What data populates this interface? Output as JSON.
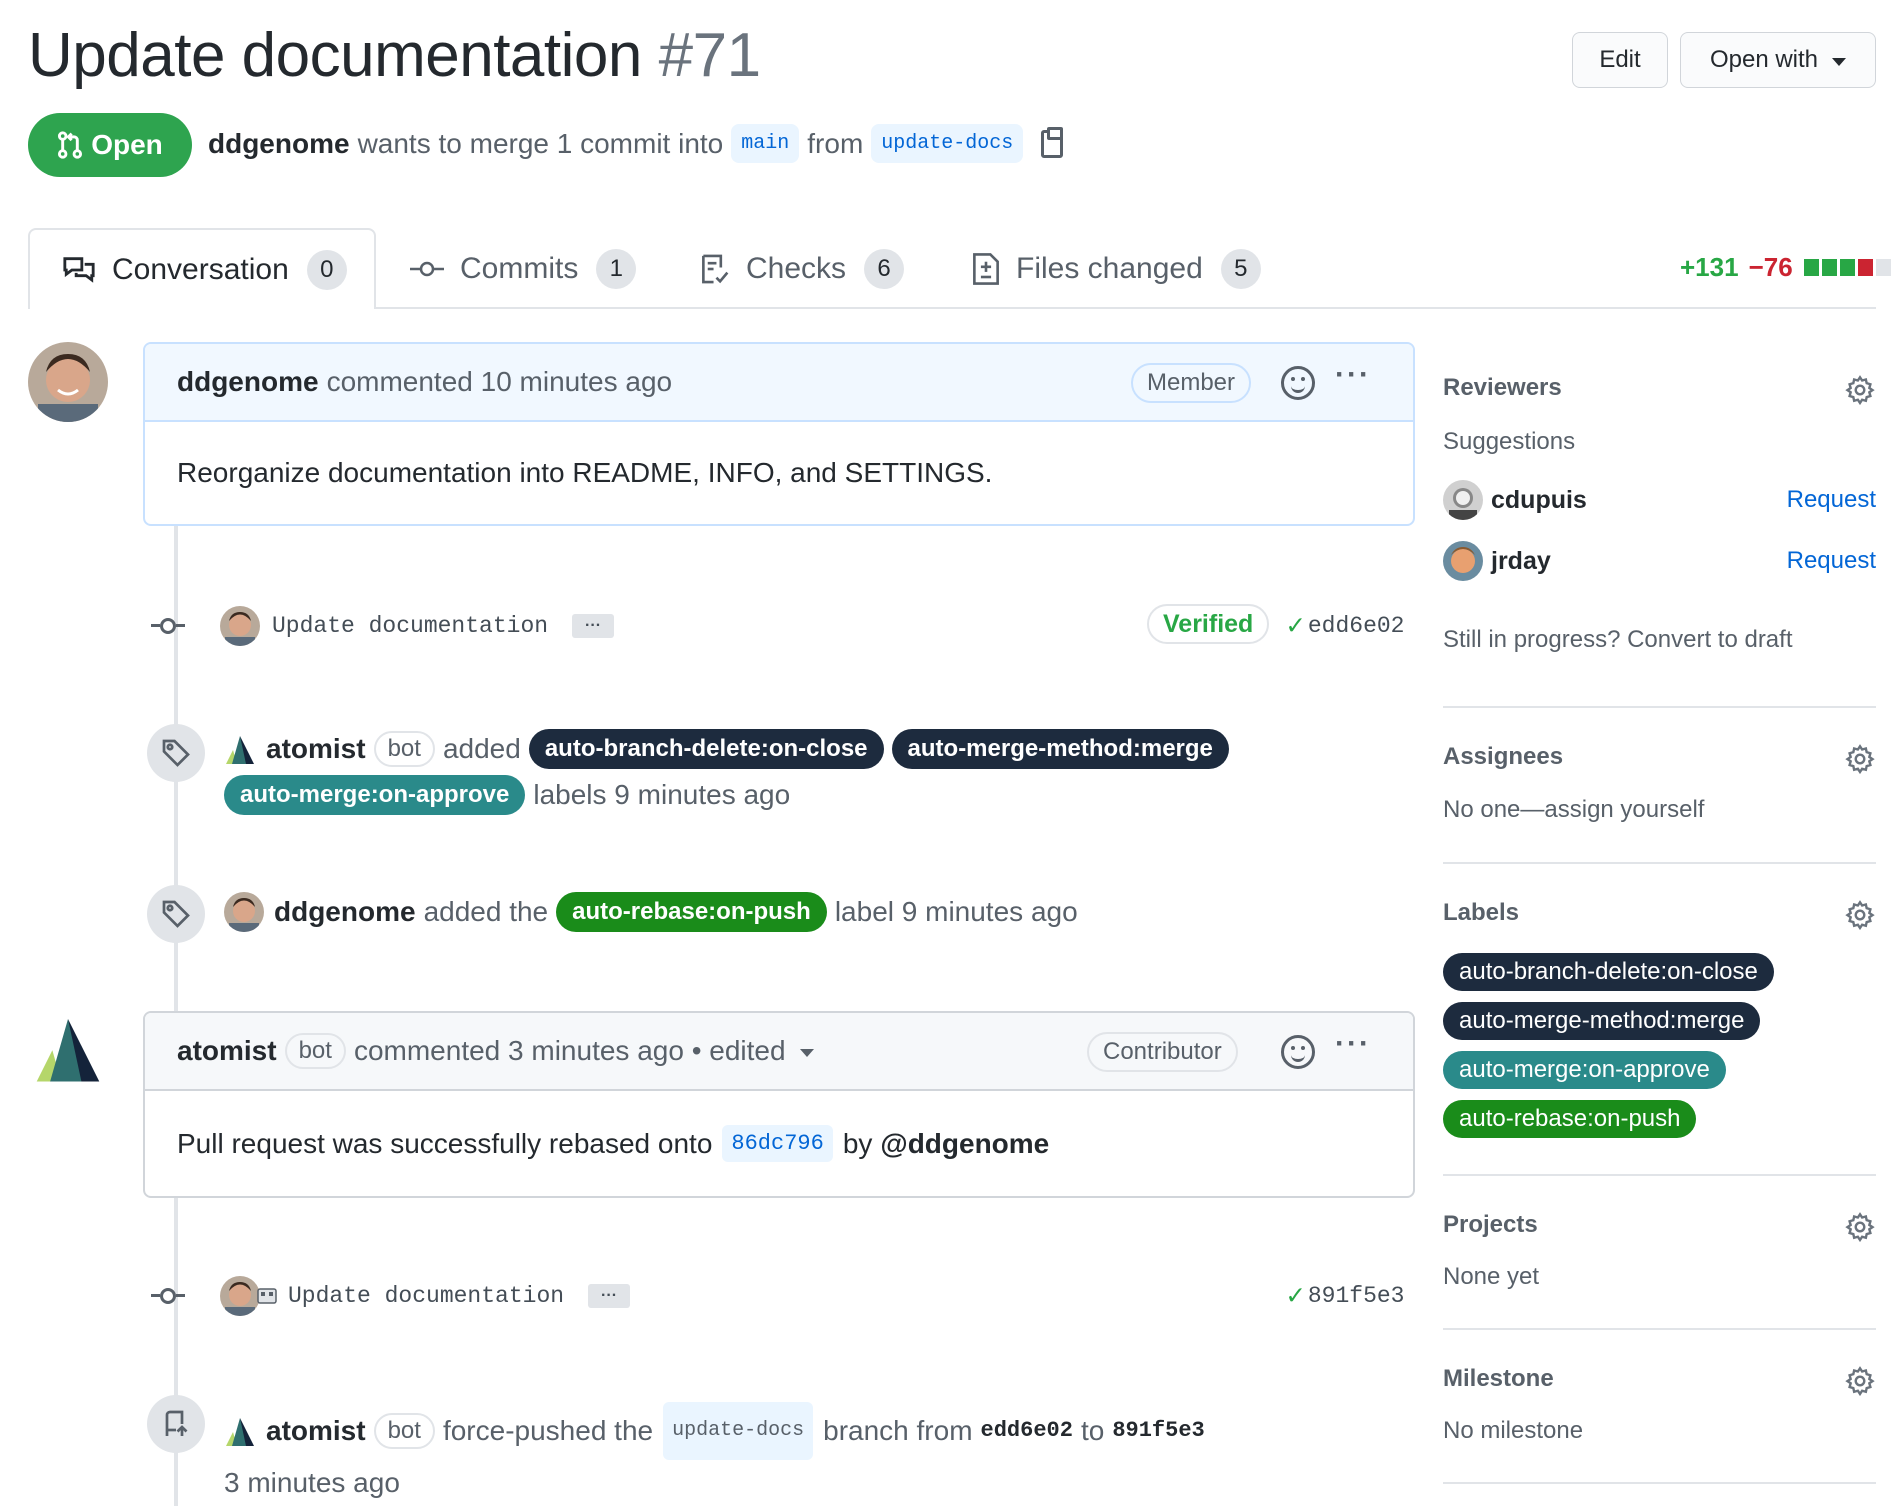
{
  "header": {
    "title": "Update documentation",
    "number": "#71",
    "edit_label": "Edit",
    "open_with_label": "Open with",
    "state_label": "Open",
    "author": "ddgenome",
    "merge_text": "wants to merge 1 commit into",
    "base_branch": "main",
    "from_text": "from",
    "head_branch": "update-docs"
  },
  "tabs": [
    {
      "label": "Conversation",
      "count": "0"
    },
    {
      "label": "Commits",
      "count": "1"
    },
    {
      "label": "Checks",
      "count": "6"
    },
    {
      "label": "Files changed",
      "count": "5"
    }
  ],
  "diffstat": {
    "additions": "+131",
    "deletions": "−76",
    "colors": [
      "#28a745",
      "#28a745",
      "#28a745",
      "#cb2431",
      "#e1e4e8"
    ]
  },
  "timeline": {
    "comment1": {
      "author": "ddgenome",
      "action": "commented 10 minutes ago",
      "role": "Member",
      "body": "Reorganize documentation into README, INFO, and SETTINGS."
    },
    "commit1": {
      "message": "Update documentation",
      "verified": "Verified",
      "sha": "edd6e02"
    },
    "event_labels1": {
      "actor": "atomist",
      "bot": "bot",
      "verb": "added",
      "labels": [
        "auto-branch-delete:on-close",
        "auto-merge-method:merge",
        "auto-merge:on-approve"
      ],
      "suffix": "labels 9 minutes ago"
    },
    "event_labels2": {
      "actor": "ddgenome",
      "verb": "added the",
      "label": "auto-rebase:on-push",
      "suffix": "label 9 minutes ago"
    },
    "comment2": {
      "author": "atomist",
      "bot": "bot",
      "action": "commented 3 minutes ago • edited",
      "role": "Contributor",
      "body_prefix": "Pull request was successfully rebased onto",
      "body_sha": "86dc796",
      "body_by": "by",
      "body_user": "@ddgenome"
    },
    "commit2": {
      "message": "Update documentation",
      "sha": "891f5e3"
    },
    "event_push": {
      "actor": "atomist",
      "bot": "bot",
      "verb": "force-pushed the",
      "branch": "update-docs",
      "from_text": "branch from",
      "from_sha": "edd6e02",
      "to_text": "to",
      "to_sha": "891f5e3",
      "time": "3 minutes ago"
    }
  },
  "sidebar": {
    "reviewers": {
      "title": "Reviewers",
      "suggestions": "Suggestions",
      "people": [
        {
          "name": "cdupuis",
          "action": "Request"
        },
        {
          "name": "jrday",
          "action": "Request"
        }
      ],
      "draft_text": "Still in progress? Convert to draft"
    },
    "assignees": {
      "title": "Assignees",
      "text": "No one—assign yourself"
    },
    "labels": {
      "title": "Labels",
      "items": [
        "auto-branch-delete:on-close",
        "auto-merge-method:merge",
        "auto-merge:on-approve",
        "auto-rebase:on-push"
      ]
    },
    "projects": {
      "title": "Projects",
      "text": "None yet"
    },
    "milestone": {
      "title": "Milestone",
      "text": "No milestone"
    }
  }
}
